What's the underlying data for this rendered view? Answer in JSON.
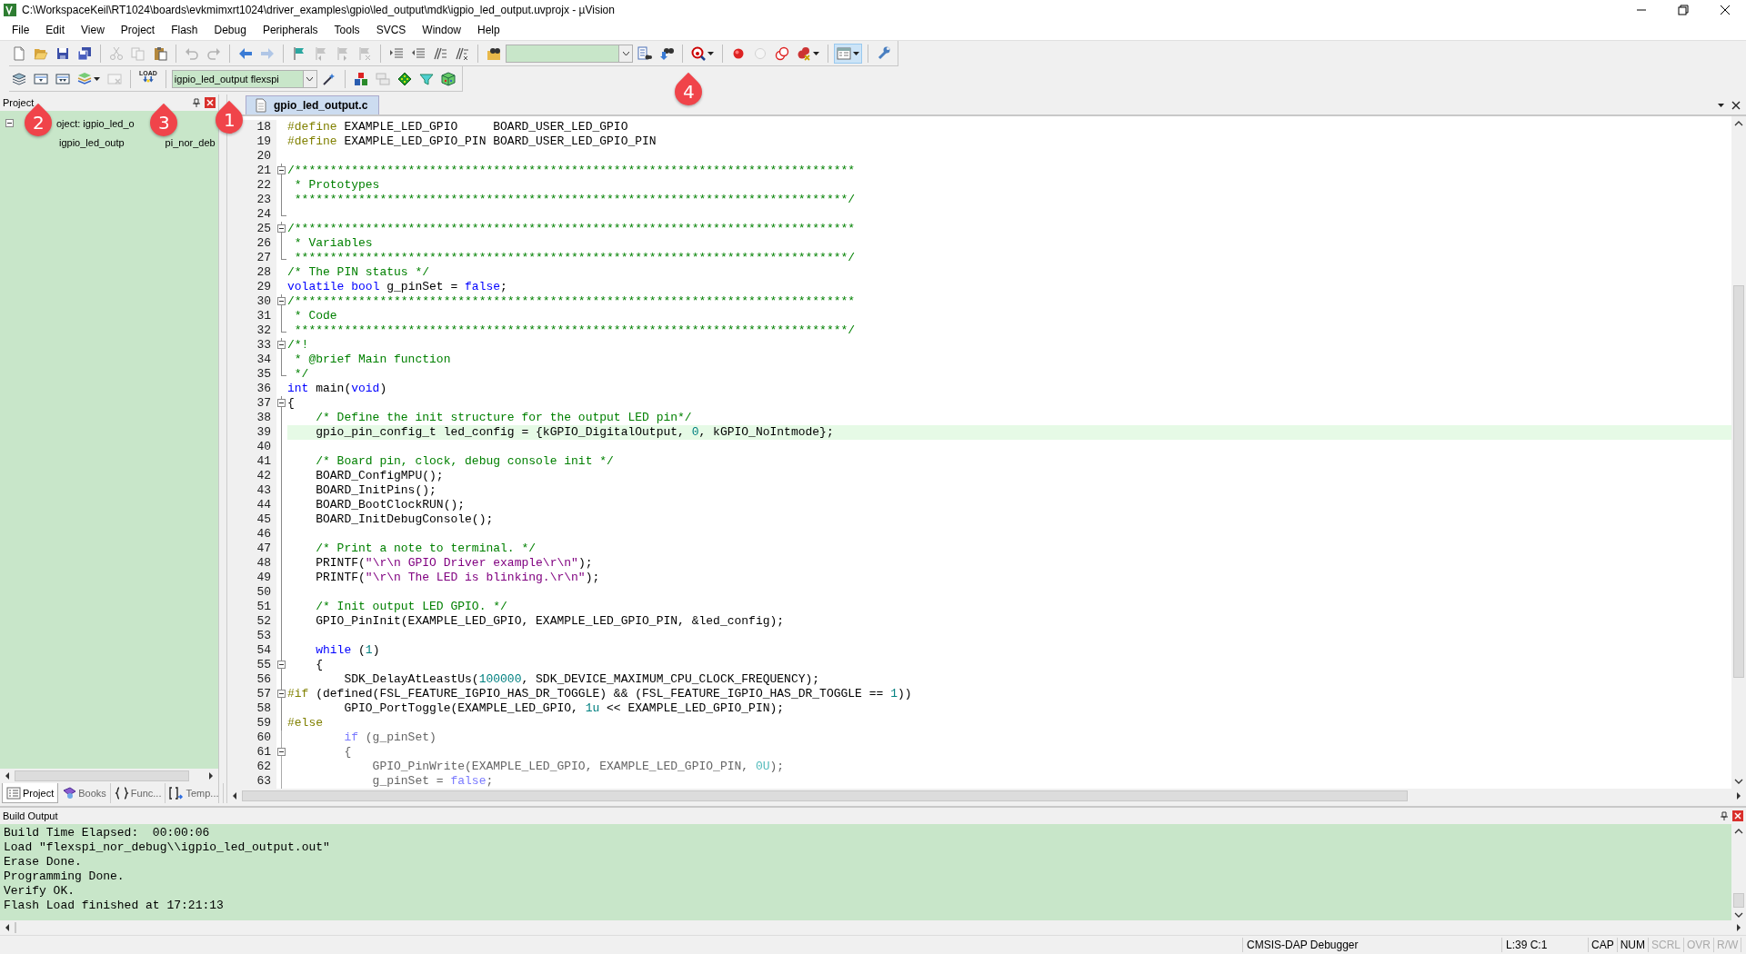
{
  "window": {
    "title": "C:\\WorkspaceKeil\\RT1024\\boards\\evkmimxrt1024\\driver_examples\\gpio\\led_output\\mdk\\igpio_led_output.uvprojx - µVision"
  },
  "menu": [
    "File",
    "Edit",
    "View",
    "Project",
    "Flash",
    "Debug",
    "Peripherals",
    "Tools",
    "SVCS",
    "Window",
    "Help"
  ],
  "toolbar_1": [
    {
      "kind": "button",
      "disabled": false,
      "pressed": false
    },
    {
      "kind": "button",
      "disabled": false,
      "pressed": false
    },
    {
      "kind": "button",
      "disabled": false,
      "pressed": false
    },
    {
      "kind": "button",
      "disabled": false,
      "pressed": false
    },
    {
      "kind": "separator"
    },
    {
      "kind": "button",
      "disabled": true,
      "pressed": false
    },
    {
      "kind": "button",
      "disabled": true,
      "pressed": false
    },
    {
      "kind": "button",
      "disabled": false,
      "pressed": false
    },
    {
      "kind": "separator"
    },
    {
      "kind": "button",
      "disabled": true,
      "pressed": false
    },
    {
      "kind": "button",
      "disabled": true,
      "pressed": false
    },
    {
      "kind": "separator"
    },
    {
      "kind": "button",
      "disabled": false,
      "pressed": false
    },
    {
      "kind": "button",
      "disabled": true,
      "pressed": false
    },
    {
      "kind": "separator"
    },
    {
      "kind": "button",
      "disabled": false,
      "pressed": false
    },
    {
      "kind": "button",
      "disabled": true,
      "pressed": false
    },
    {
      "kind": "button",
      "disabled": true,
      "pressed": false
    },
    {
      "kind": "button",
      "disabled": true,
      "pressed": false
    },
    {
      "kind": "separator"
    },
    {
      "kind": "button",
      "disabled": false,
      "pressed": false
    },
    {
      "kind": "button",
      "disabled": false,
      "pressed": false
    },
    {
      "kind": "button",
      "disabled": false,
      "pressed": false
    },
    {
      "kind": "button",
      "disabled": false,
      "pressed": false
    },
    {
      "kind": "separator"
    },
    {
      "kind": "button",
      "disabled": false,
      "pressed": false
    },
    {
      "kind": "combo"
    },
    {
      "kind": "button",
      "disabled": false,
      "pressed": false
    },
    {
      "kind": "button",
      "disabled": false,
      "pressed": false
    },
    {
      "kind": "separator"
    },
    {
      "kind": "button",
      "disabled": false,
      "pressed": false
    },
    {
      "kind": "separator"
    },
    {
      "kind": "button",
      "disabled": false,
      "pressed": false
    },
    {
      "kind": "button",
      "disabled": true,
      "pressed": false
    },
    {
      "kind": "button",
      "disabled": false,
      "pressed": false
    },
    {
      "kind": "button",
      "disabled": false,
      "pressed": false
    },
    {
      "kind": "separator"
    },
    {
      "kind": "button",
      "disabled": false,
      "pressed": true
    },
    {
      "kind": "separator"
    },
    {
      "kind": "button",
      "disabled": false,
      "pressed": false
    }
  ],
  "toolbar_2": [
    {
      "kind": "button",
      "disabled": false,
      "pressed": false
    },
    {
      "kind": "button",
      "disabled": false,
      "pressed": false
    },
    {
      "kind": "button",
      "disabled": false,
      "pressed": false
    },
    {
      "kind": "button",
      "disabled": false,
      "pressed": false
    },
    {
      "kind": "button",
      "disabled": true,
      "pressed": false
    },
    {
      "kind": "separator"
    },
    {
      "kind": "button",
      "disabled": false,
      "pressed": false,
      "label": "LOAD"
    },
    {
      "kind": "separator"
    },
    {
      "kind": "combo",
      "value": "igpio_led_output flexspi"
    },
    {
      "kind": "button",
      "disabled": false,
      "pressed": false
    },
    {
      "kind": "separator"
    },
    {
      "kind": "button",
      "disabled": false,
      "pressed": false
    },
    {
      "kind": "button",
      "disabled": true,
      "pressed": false
    },
    {
      "kind": "button",
      "disabled": false,
      "pressed": false
    },
    {
      "kind": "button",
      "disabled": false,
      "pressed": false
    },
    {
      "kind": "button",
      "disabled": false,
      "pressed": false
    }
  ],
  "callouts": [
    {
      "text": "2"
    },
    {
      "text": "3"
    },
    {
      "text": "1"
    },
    {
      "text": "4"
    }
  ],
  "project_panel": {
    "title": "Project",
    "tree": [
      {
        "text": "oject: igpio_led_o",
        "expanded": true,
        "children": [
          {
            "text": "igpio_led_outp",
            "text_after": "pi_nor_deb"
          }
        ]
      }
    ],
    "tabs": [
      {
        "label": "Project",
        "selected": true
      },
      {
        "label": "Books",
        "selected": false
      },
      {
        "label": "Func...",
        "selected": false
      },
      {
        "label": "Temp...",
        "selected": false
      }
    ]
  },
  "editor": {
    "tabs": [
      {
        "label": "gpio_led_output.c",
        "selected": true
      }
    ],
    "lines": [
      {
        "num": "18",
        "fold_start": false,
        "fold_end": false,
        "highlight": false,
        "inactive": false,
        "tokens": [
          {
            "kind": "pp",
            "text": "#define"
          },
          {
            "kind": "plain",
            "text": " EXAMPLE_LED_GPIO     BOARD_USER_LED_GPIO"
          }
        ]
      },
      {
        "num": "19",
        "fold_start": false,
        "fold_end": false,
        "highlight": false,
        "inactive": false,
        "tokens": [
          {
            "kind": "pp",
            "text": "#define"
          },
          {
            "kind": "plain",
            "text": " EXAMPLE_LED_GPIO_PIN BOARD_USER_LED_GPIO_PIN"
          }
        ]
      },
      {
        "num": "20",
        "fold_start": false,
        "fold_end": false,
        "highlight": false
      },
      {
        "num": "21",
        "fold_start": true,
        "fold_end": false,
        "highlight": false,
        "inactive": false,
        "tokens": [
          {
            "kind": "comment",
            "text": "/*******************************************************************************"
          }
        ]
      },
      {
        "num": "22",
        "fold_start": false,
        "fold_end": false,
        "highlight": false,
        "inactive": false,
        "tokens": [
          {
            "kind": "comment",
            "text": " * Prototypes"
          }
        ]
      },
      {
        "num": "23",
        "fold_start": false,
        "fold_end": false,
        "highlight": false,
        "inactive": false,
        "tokens": [
          {
            "kind": "comment",
            "text": " ******************************************************************************/"
          }
        ]
      },
      {
        "num": "24",
        "fold_start": false,
        "fold_end": true,
        "highlight": false
      },
      {
        "num": "25",
        "fold_start": true,
        "fold_end": false,
        "highlight": false,
        "inactive": false,
        "tokens": [
          {
            "kind": "comment",
            "text": "/*******************************************************************************"
          }
        ]
      },
      {
        "num": "26",
        "fold_start": false,
        "fold_end": false,
        "highlight": false,
        "inactive": false,
        "tokens": [
          {
            "kind": "comment",
            "text": " * Variables"
          }
        ]
      },
      {
        "num": "27",
        "fold_start": false,
        "fold_end": true,
        "highlight": false,
        "inactive": false,
        "tokens": [
          {
            "kind": "comment",
            "text": " ******************************************************************************/"
          }
        ]
      },
      {
        "num": "28",
        "fold_start": false,
        "fold_end": false,
        "highlight": false,
        "inactive": false,
        "tokens": [
          {
            "kind": "comment",
            "text": "/* The PIN status */"
          }
        ]
      },
      {
        "num": "29",
        "fold_start": false,
        "fold_end": false,
        "highlight": false,
        "inactive": false,
        "tokens": [
          {
            "kind": "kw",
            "text": "volatile"
          },
          {
            "kind": "kw",
            "text": " bool"
          },
          {
            "kind": "plain",
            "text": " g_pinSet = "
          },
          {
            "kind": "kw",
            "text": "false"
          },
          {
            "kind": "plain",
            "text": ";"
          }
        ]
      },
      {
        "num": "30",
        "fold_start": true,
        "fold_end": false,
        "highlight": false,
        "inactive": false,
        "tokens": [
          {
            "kind": "comment",
            "text": "/*******************************************************************************"
          }
        ]
      },
      {
        "num": "31",
        "fold_start": false,
        "fold_end": false,
        "highlight": false,
        "inactive": false,
        "tokens": [
          {
            "kind": "comment",
            "text": " * Code"
          }
        ]
      },
      {
        "num": "32",
        "fold_start": false,
        "fold_end": true,
        "highlight": false,
        "inactive": false,
        "tokens": [
          {
            "kind": "comment",
            "text": " ******************************************************************************/"
          }
        ]
      },
      {
        "num": "33",
        "fold_start": true,
        "fold_end": false,
        "highlight": false,
        "inactive": false,
        "tokens": [
          {
            "kind": "comment",
            "text": "/*!"
          }
        ]
      },
      {
        "num": "34",
        "fold_start": false,
        "fold_end": false,
        "highlight": false,
        "inactive": false,
        "tokens": [
          {
            "kind": "comment",
            "text": " * @brief Main function"
          }
        ]
      },
      {
        "num": "35",
        "fold_start": false,
        "fold_end": true,
        "highlight": false,
        "inactive": false,
        "tokens": [
          {
            "kind": "comment",
            "text": " */"
          }
        ]
      },
      {
        "num": "36",
        "fold_start": false,
        "fold_end": false,
        "highlight": false,
        "inactive": false,
        "tokens": [
          {
            "kind": "kw",
            "text": "int"
          },
          {
            "kind": "plain",
            "text": " main("
          },
          {
            "kind": "kw",
            "text": "void"
          },
          {
            "kind": "plain",
            "text": ")"
          }
        ]
      },
      {
        "num": "37",
        "fold_start": true,
        "fold_end": false,
        "highlight": false,
        "inactive": false,
        "tokens": [
          {
            "kind": "plain",
            "text": "{"
          }
        ]
      },
      {
        "num": "38",
        "fold_start": false,
        "fold_end": false,
        "highlight": false,
        "inactive": false,
        "tokens": [
          {
            "kind": "comment",
            "text": "    /* Define the init structure for the output LED pin*/"
          }
        ]
      },
      {
        "num": "39",
        "fold_start": false,
        "fold_end": false,
        "highlight": true,
        "inactive": false,
        "tokens": [
          {
            "kind": "plain",
            "text": "    gpio_pin_config_t led_config = {kGPIO_DigitalOutput, "
          },
          {
            "kind": "num",
            "text": "0"
          },
          {
            "kind": "plain",
            "text": ", kGPIO_NoIntmode};"
          }
        ]
      },
      {
        "num": "40",
        "fold_start": false,
        "fold_end": false,
        "highlight": false
      },
      {
        "num": "41",
        "fold_start": false,
        "fold_end": false,
        "highlight": false,
        "inactive": false,
        "tokens": [
          {
            "kind": "comment",
            "text": "    /* Board pin, clock, debug console init */"
          }
        ]
      },
      {
        "num": "42",
        "fold_start": false,
        "fold_end": false,
        "highlight": false,
        "inactive": false,
        "tokens": [
          {
            "kind": "plain",
            "text": "    BOARD_ConfigMPU();"
          }
        ]
      },
      {
        "num": "43",
        "fold_start": false,
        "fold_end": false,
        "highlight": false,
        "inactive": false,
        "tokens": [
          {
            "kind": "plain",
            "text": "    BOARD_InitPins();"
          }
        ]
      },
      {
        "num": "44",
        "fold_start": false,
        "fold_end": false,
        "highlight": false,
        "inactive": false,
        "tokens": [
          {
            "kind": "plain",
            "text": "    BOARD_BootClockRUN();"
          }
        ]
      },
      {
        "num": "45",
        "fold_start": false,
        "fold_end": false,
        "highlight": false,
        "inactive": false,
        "tokens": [
          {
            "kind": "plain",
            "text": "    BOARD_InitDebugConsole();"
          }
        ]
      },
      {
        "num": "46",
        "fold_start": false,
        "fold_end": false,
        "highlight": false
      },
      {
        "num": "47",
        "fold_start": false,
        "fold_end": false,
        "highlight": false,
        "inactive": false,
        "tokens": [
          {
            "kind": "comment",
            "text": "    /* Print a note to terminal. */"
          }
        ]
      },
      {
        "num": "48",
        "fold_start": false,
        "fold_end": false,
        "highlight": false,
        "inactive": false,
        "tokens": [
          {
            "kind": "plain",
            "text": "    PRINTF("
          },
          {
            "kind": "str",
            "text": "\"\\r\\n GPIO Driver example\\r\\n\""
          },
          {
            "kind": "plain",
            "text": ");"
          }
        ]
      },
      {
        "num": "49",
        "fold_start": false,
        "fold_end": false,
        "highlight": false,
        "inactive": false,
        "tokens": [
          {
            "kind": "plain",
            "text": "    PRINTF("
          },
          {
            "kind": "str",
            "text": "\"\\r\\n The LED is blinking.\\r\\n\""
          },
          {
            "kind": "plain",
            "text": ");"
          }
        ]
      },
      {
        "num": "50",
        "fold_start": false,
        "fold_end": false,
        "highlight": false
      },
      {
        "num": "51",
        "fold_start": false,
        "fold_end": false,
        "highlight": false,
        "inactive": false,
        "tokens": [
          {
            "kind": "comment",
            "text": "    /* Init output LED GPIO. */"
          }
        ]
      },
      {
        "num": "52",
        "fold_start": false,
        "fold_end": false,
        "highlight": false,
        "inactive": false,
        "tokens": [
          {
            "kind": "plain",
            "text": "    GPIO_PinInit(EXAMPLE_LED_GPIO, EXAMPLE_LED_GPIO_PIN, &led_config);"
          }
        ]
      },
      {
        "num": "53",
        "fold_start": false,
        "fold_end": false,
        "highlight": false
      },
      {
        "num": "54",
        "fold_start": false,
        "fold_end": false,
        "highlight": false,
        "inactive": false,
        "tokens": [
          {
            "kind": "kw",
            "text": "    while"
          },
          {
            "kind": "plain",
            "text": " ("
          },
          {
            "kind": "num",
            "text": "1"
          },
          {
            "kind": "plain",
            "text": ")"
          }
        ]
      },
      {
        "num": "55",
        "fold_start": true,
        "fold_end": false,
        "highlight": false,
        "inactive": false,
        "tokens": [
          {
            "kind": "plain",
            "text": "    {"
          }
        ]
      },
      {
        "num": "56",
        "fold_start": false,
        "fold_end": false,
        "highlight": false,
        "inactive": false,
        "tokens": [
          {
            "kind": "plain",
            "text": "        SDK_DelayAtLeastUs("
          },
          {
            "kind": "num",
            "text": "100000"
          },
          {
            "kind": "plain",
            "text": ", SDK_DEVICE_MAXIMUM_CPU_CLOCK_FREQUENCY);"
          }
        ]
      },
      {
        "num": "57",
        "fold_start": true,
        "fold_end": false,
        "highlight": false,
        "inactive": false,
        "tokens": [
          {
            "kind": "pp",
            "text": "#if"
          },
          {
            "kind": "plain",
            "text": " (defined(FSL_FEATURE_IGPIO_HAS_DR_TOGGLE) && (FSL_FEATURE_IGPIO_HAS_DR_TOGGLE == "
          },
          {
            "kind": "num",
            "text": "1"
          },
          {
            "kind": "plain",
            "text": "))"
          }
        ]
      },
      {
        "num": "58",
        "fold_start": false,
        "fold_end": false,
        "highlight": false,
        "inactive": false,
        "tokens": [
          {
            "kind": "plain",
            "text": "        GPIO_PortToggle(EXAMPLE_LED_GPIO, "
          },
          {
            "kind": "num",
            "text": "1u"
          },
          {
            "kind": "plain",
            "text": " << EXAMPLE_LED_GPIO_PIN);"
          }
        ]
      },
      {
        "num": "59",
        "fold_start": false,
        "fold_end": false,
        "highlight": false,
        "inactive": false,
        "tokens": [
          {
            "kind": "pp",
            "text": "#else"
          }
        ]
      },
      {
        "num": "60",
        "fold_start": false,
        "fold_end": false,
        "highlight": false,
        "inactive": true,
        "tokens": [
          {
            "kind": "kw",
            "text": "        if"
          },
          {
            "kind": "plain",
            "text": " (g_pinSet)"
          }
        ]
      },
      {
        "num": "61",
        "fold_start": true,
        "fold_end": false,
        "highlight": false,
        "inactive": true,
        "tokens": [
          {
            "kind": "plain",
            "text": "        {"
          }
        ]
      },
      {
        "num": "62",
        "fold_start": false,
        "fold_end": false,
        "highlight": false,
        "inactive": true,
        "tokens": [
          {
            "kind": "plain",
            "text": "            GPIO_PinWrite(EXAMPLE_LED_GPIO, EXAMPLE_LED_GPIO_PIN, "
          },
          {
            "kind": "num",
            "text": "0U"
          },
          {
            "kind": "plain",
            "text": ");"
          }
        ]
      },
      {
        "num": "63",
        "fold_start": false,
        "fold_end": false,
        "highlight": false,
        "inactive": true,
        "tokens": [
          {
            "kind": "plain",
            "text": "            g_pinSet = "
          },
          {
            "kind": "kw",
            "text": "false"
          },
          {
            "kind": "plain",
            "text": ";"
          }
        ]
      }
    ]
  },
  "build_output": {
    "title": "Build Output",
    "lines": [
      "Build Time Elapsed:  00:00:06",
      "Load \"flexspi_nor_debug\\\\igpio_led_output.out\"",
      "Erase Done.",
      "Programming Done.",
      "Verify OK.",
      "Flash Load finished at 17:21:13"
    ]
  },
  "status_bar": {
    "debugger": "CMSIS-DAP Debugger",
    "position": "L:39 C:1",
    "indicators": [
      {
        "text": "CAP",
        "on": true
      },
      {
        "text": "NUM",
        "on": true
      },
      {
        "text": "SCRL",
        "on": false
      },
      {
        "text": "OVR",
        "on": false
      },
      {
        "text": "R/W",
        "on": false
      }
    ]
  }
}
